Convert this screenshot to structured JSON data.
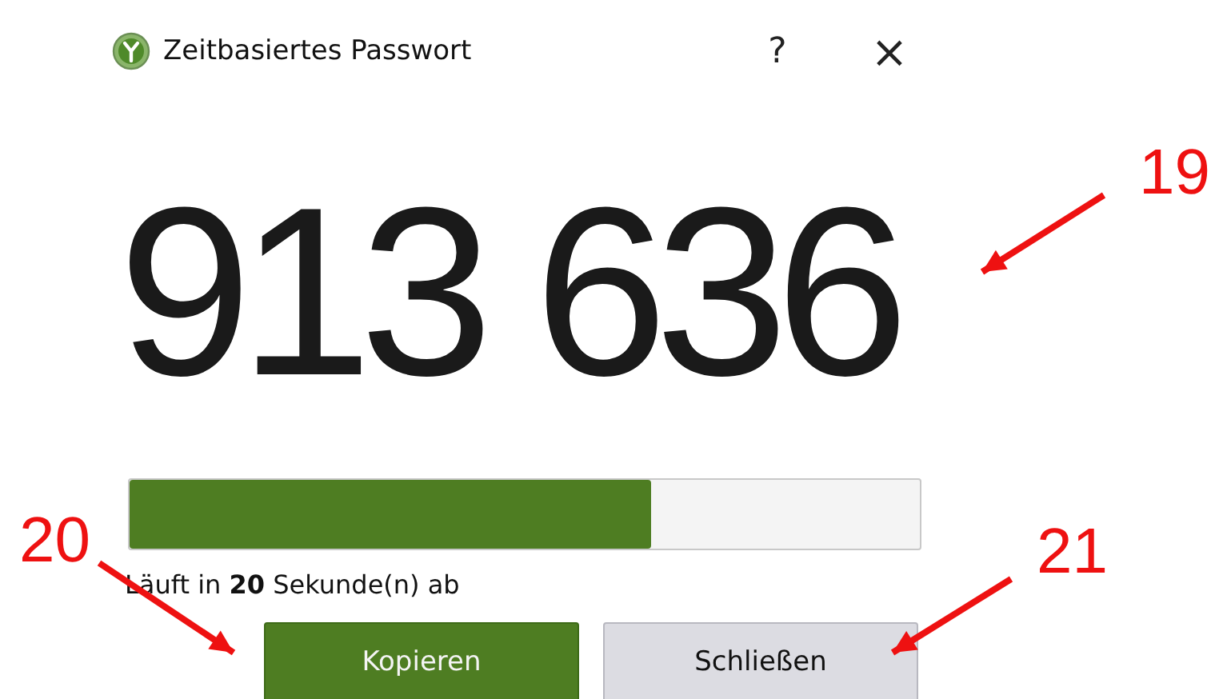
{
  "window": {
    "title": "Zeitbasiertes Passwort",
    "help_button": "?",
    "close_button": "×"
  },
  "code": "913 636",
  "progress": {
    "level": 0.66
  },
  "expiry_text": "Läuft in **20** Sekunde(n) ab",
  "buttons": [
    {
      "label": "Kopieren",
      "kind": "primary"
    },
    {
      "label": "Schließen",
      "kind": "secondary"
    }
  ],
  "annotations": [
    {
      "label": "19"
    },
    {
      "label": "20"
    },
    {
      "label": "21"
    }
  ]
}
